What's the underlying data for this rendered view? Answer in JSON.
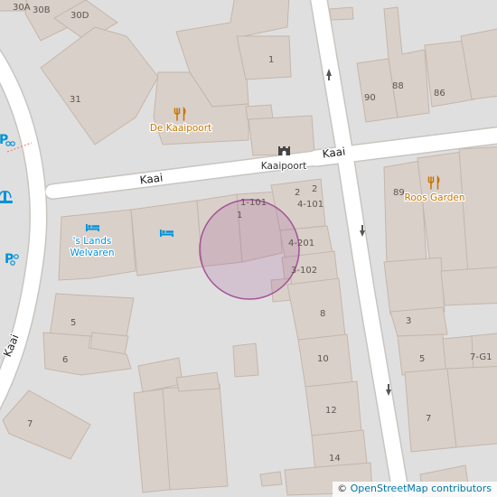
{
  "map": {
    "streets": [
      {
        "id": "kaai-top",
        "label": "Kaai"
      },
      {
        "id": "kaai-mid",
        "label": "Kaai"
      },
      {
        "id": "kaai-left",
        "label": "Kaai"
      }
    ],
    "house_numbers": [
      "30A",
      "30B",
      "30D",
      "31",
      "1",
      "90",
      "88",
      "86",
      "2",
      "2",
      "4-101",
      "1-101",
      "1",
      "4-201",
      "3-102",
      "8",
      "10",
      "12",
      "14",
      "89",
      "3",
      "5",
      "7-G1",
      "7",
      "5",
      "6",
      "7"
    ],
    "pois": [
      {
        "type": "restaurant",
        "icon": "fork-knife-icon",
        "label": "De Kaaipoort"
      },
      {
        "type": "restaurant",
        "icon": "fork-knife-icon",
        "label": "Roos Garden"
      },
      {
        "type": "city-gate",
        "icon": "castle-gate-icon",
        "label": "Kaaipoort"
      },
      {
        "type": "hotel",
        "icon": "bed-icon",
        "label": "'s Lands Welvaren"
      },
      {
        "type": "hotel",
        "icon": "bed-icon",
        "label": ""
      },
      {
        "type": "parking",
        "icon": "parking-icon",
        "label": ""
      },
      {
        "type": "parking",
        "icon": "parking-icon",
        "label": ""
      },
      {
        "type": "fountain",
        "icon": "fountain-icon",
        "label": ""
      }
    ],
    "hotel_label_lines": [
      "'s Lands",
      "Welvaren"
    ],
    "marker": {
      "type": "location-circle",
      "color": "#a25296"
    },
    "colors": {
      "background": "#e0dfdf",
      "building": "#d9d0c9",
      "road": "#ffffff",
      "food": "#c77400",
      "hotel": "#0092da",
      "parking": "#0092da"
    }
  },
  "attribution": {
    "symbol": "©",
    "text": "OpenStreetMap contributors"
  }
}
